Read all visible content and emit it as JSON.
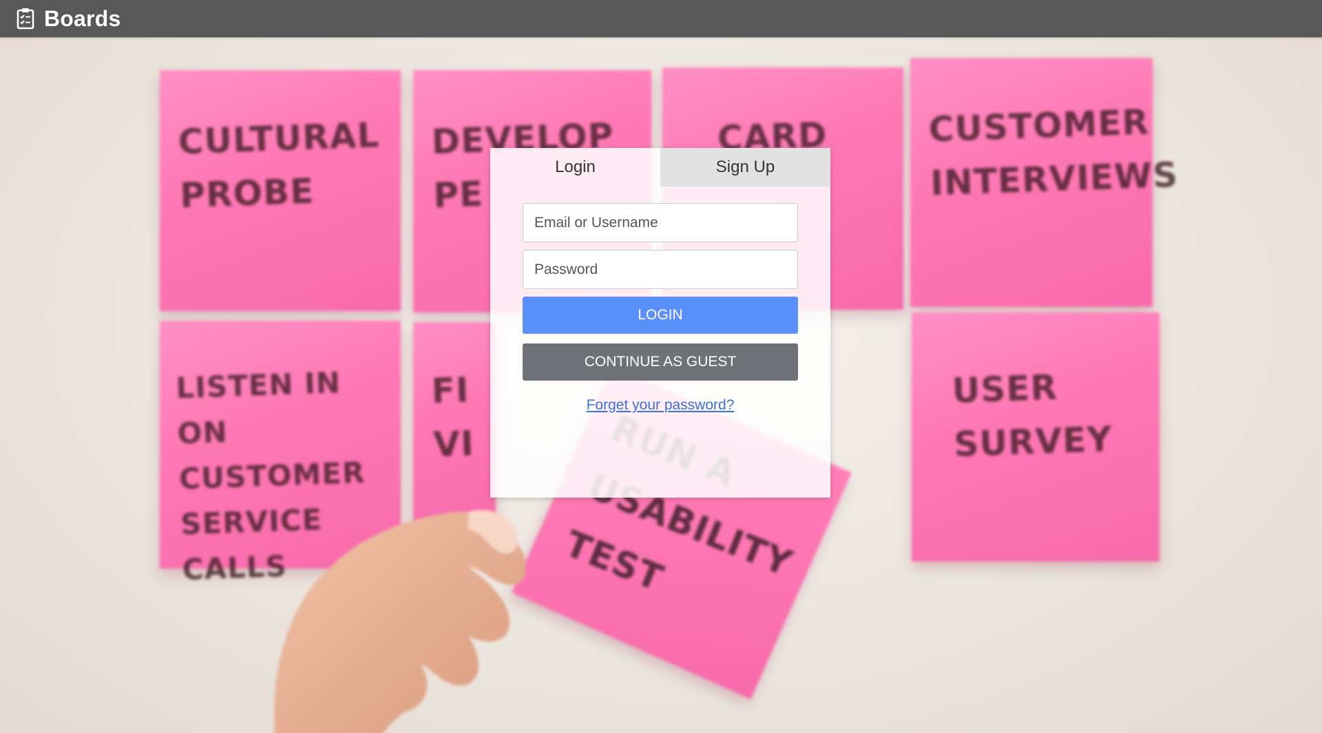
{
  "app": {
    "title": "Boards",
    "icon": "clipboard-checklist-icon"
  },
  "background": {
    "notes": [
      {
        "text": "CULTURAL\nPROBE"
      },
      {
        "text": "DEVELOP\nPE"
      },
      {
        "text": "CARD"
      },
      {
        "text": "CUSTOMER\nINTERVIEWS"
      },
      {
        "text": "LISTEN IN ON\nCUSTOMER\nSERVICE CALLS"
      },
      {
        "text": "FI\nVI"
      },
      {
        "text": "USER\nSURVEY"
      },
      {
        "text": "RUN A\nUSABILITY\nTEST"
      }
    ]
  },
  "auth": {
    "tabs": [
      {
        "label": "Login",
        "active": true
      },
      {
        "label": "Sign Up",
        "active": false
      }
    ],
    "email_placeholder": "Email or Username",
    "email_value": "",
    "password_placeholder": "Password",
    "password_value": "",
    "login_label": "LOGIN",
    "guest_label": "CONTINUE AS GUEST",
    "forgot_label": "Forget your password?"
  },
  "colors": {
    "topbar": "#585858",
    "login_button": "#5b8ff9",
    "guest_button": "#6e7276",
    "link": "#3b72d9",
    "note_pink": "#ff7db8"
  }
}
